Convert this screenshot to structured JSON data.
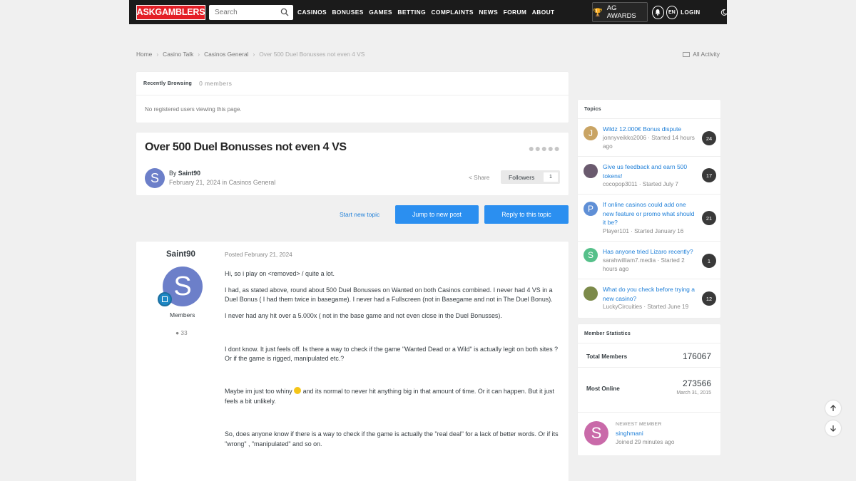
{
  "header": {
    "logo": "ASKGAMBLERS",
    "search_placeholder": "Search",
    "nav": [
      "CASINOS",
      "BONUSES",
      "GAMES",
      "BETTING",
      "COMPLAINTS",
      "NEWS",
      "FORUM",
      "ABOUT"
    ],
    "awards": "AG AWARDS",
    "lang": "EN",
    "login": "LOGIN"
  },
  "breadcrumb": [
    "Home",
    "Casino Talk",
    "Casinos General",
    "Over 500 Duel Bonusses not even 4 VS"
  ],
  "all_activity": "All Activity",
  "recently_browsing": {
    "title": "Recently Browsing",
    "count": "0 members",
    "empty": "No registered users viewing this page."
  },
  "topic": {
    "title": "Over 500 Duel Bonusses not even 4 VS",
    "avatar_letter": "S",
    "by_prefix": "By",
    "author": "Saint90",
    "date": "February 21, 2024",
    "in_text": "in",
    "forum": "Casinos General",
    "share": "Share",
    "followers_label": "Followers",
    "followers_count": "1"
  },
  "actions": {
    "start_new_topic": "Start new topic",
    "jump_to_new_post": "Jump to new post",
    "reply": "Reply to this topic"
  },
  "post": {
    "author": "Saint90",
    "avatar_letter": "S",
    "group": "Members",
    "reputation": "33",
    "posted": "Posted February 21, 2024",
    "paragraphs": [
      "Hi, so i play on <removed> / quite a lot.",
      "I had, as stated above, round about 500 Duel Bonusses on Wanted on both Casinos combined. I never had 4 VS in a Duel Bonus ( I had them twice in basegame). I never had a Fullscreen (not in Basegame and not in The Duel Bonus).",
      "I never had any hit over a 5.000x ( not in the base game and not even close in the Duel Bonusses).",
      "I dont know. It just feels off. Is there a way to check if the game \"Wanted Dead or a Wild\" is actually legit on both sites ? Or if the game is rigged, manipulated etc.?",
      "Maybe im just too whiny",
      "and its normal to never hit anything big in that amount of time. Or it can happen. But it just feels a bit unlikely.",
      "So, does anyone know if there is a way to check if the game is actually the \"real deal\" for a lack of better words. Or if its \"wrong\" , \"manipulated\" and so on."
    ]
  },
  "sidebar": {
    "topics_title": "Topics",
    "topics": [
      {
        "title": "Wildz 12.000€ Bonus dispute",
        "meta": "jonnyveikko2006 · Started 14 hours ago",
        "count": "24",
        "letter": "J",
        "color": "#c9a464"
      },
      {
        "title": "Give us feedback and earn 500 tokens!",
        "meta": "cocopop3011 · Started July 7",
        "count": "17",
        "letter": "",
        "color": "#6a5a6e"
      },
      {
        "title": "If online casinos could add one new feature or promo what should it be?",
        "meta": "Player101 · Started January 16",
        "count": "21",
        "letter": "P",
        "color": "#5f8fd6"
      },
      {
        "title": "Has anyone tried Lizaro recently?",
        "meta": "sarahwilliam7.media · Started 2 hours ago",
        "count": "1",
        "letter": "S",
        "color": "#56c08a"
      },
      {
        "title": "What do you check before trying a new casino?",
        "meta": "LuckyCircuities · Started June 19",
        "count": "12",
        "letter": "",
        "color": "#7c8a4a"
      }
    ],
    "stats_title": "Member Statistics",
    "total_members_label": "Total Members",
    "total_members": "176067",
    "most_online_label": "Most Online",
    "most_online": "273566",
    "most_online_date": "March 31, 2015",
    "newest_label": "NEWEST MEMBER",
    "newest_name": "singhmani",
    "newest_letter": "S",
    "newest_time": "Joined 29 minutes ago"
  }
}
